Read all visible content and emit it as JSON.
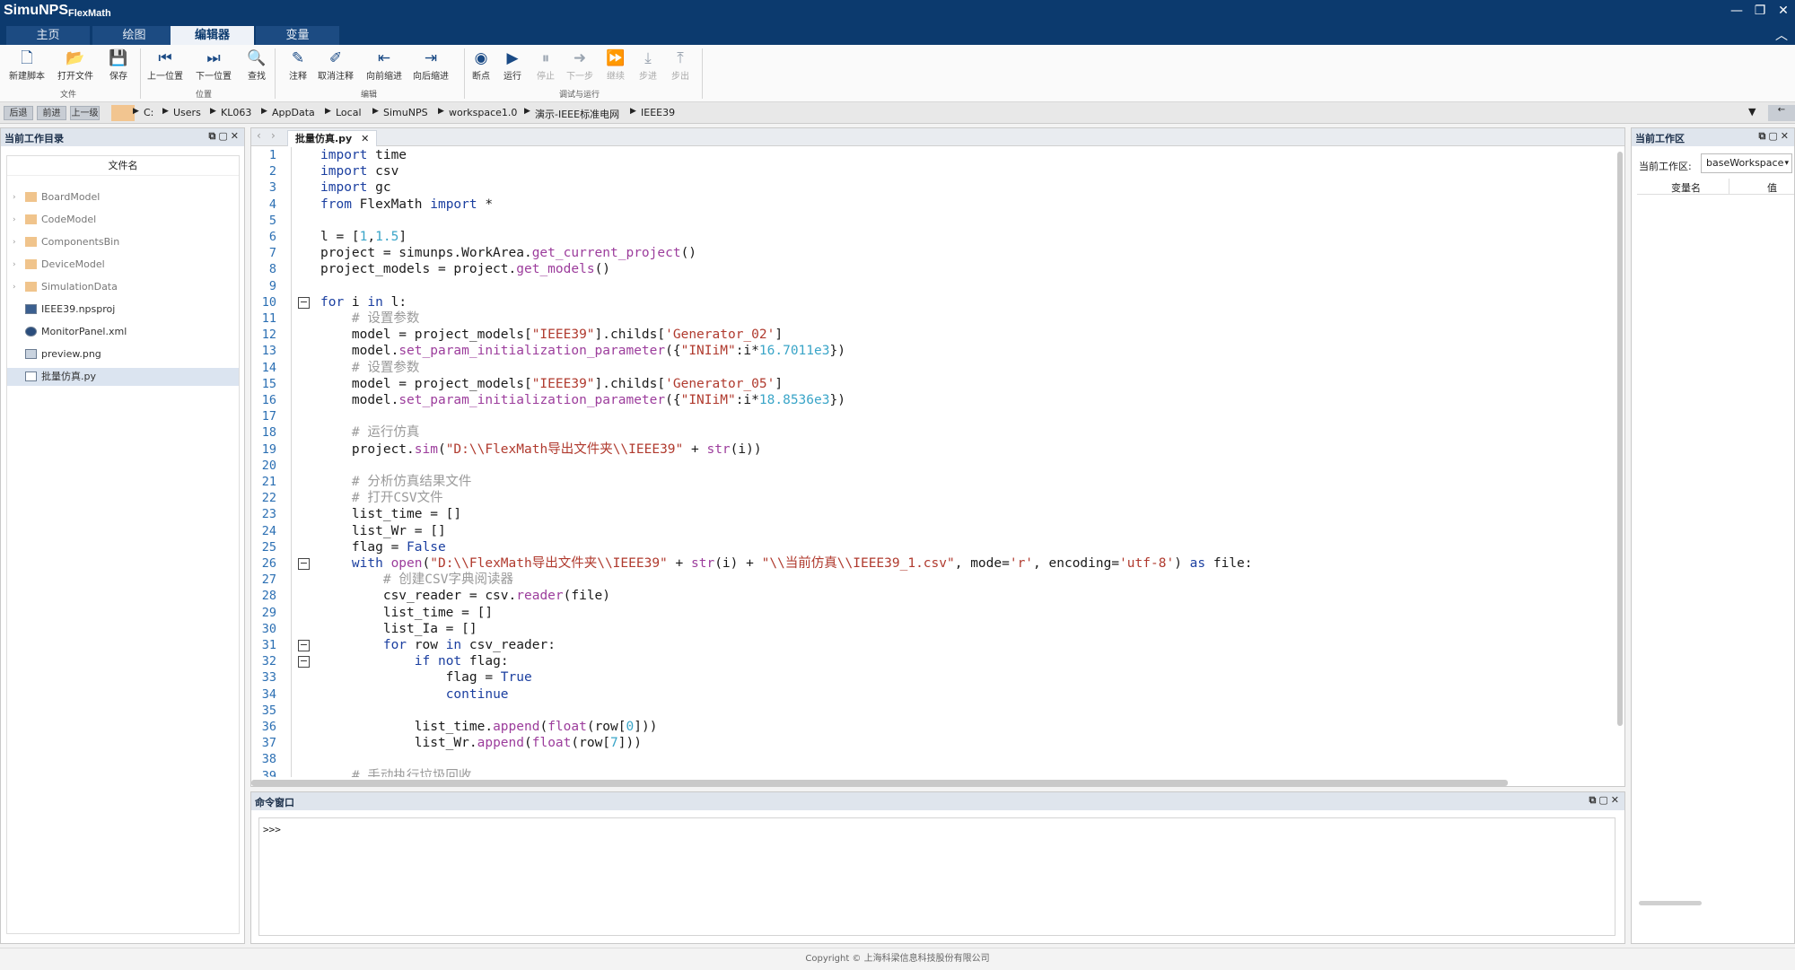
{
  "app": {
    "name": "SimuNPS",
    "subtitle": "FlexMath"
  },
  "window_controls": [
    "—",
    "❐",
    "✕"
  ],
  "tabs": [
    {
      "label": "主页",
      "active": false
    },
    {
      "label": "绘图",
      "active": false
    },
    {
      "label": "编辑器",
      "active": true
    },
    {
      "label": "变量",
      "active": false
    }
  ],
  "ribbon": {
    "buttons": [
      {
        "label": "新建脚本",
        "icon": "new-script-icon",
        "glyph": "🗋",
        "disabled": false
      },
      {
        "label": "打开文件",
        "icon": "open-file-icon",
        "glyph": "📂",
        "disabled": false
      },
      {
        "label": "保存",
        "icon": "save-icon",
        "glyph": "💾",
        "disabled": false
      },
      {
        "label": "上一位置",
        "icon": "prev-position-icon",
        "glyph": "⏮",
        "disabled": false
      },
      {
        "label": "下一位置",
        "icon": "next-position-icon",
        "glyph": "⏭",
        "disabled": false
      },
      {
        "label": "查找",
        "icon": "search-icon",
        "glyph": "🔍",
        "disabled": false
      },
      {
        "label": "注释",
        "icon": "comment-icon",
        "glyph": "✎",
        "disabled": false
      },
      {
        "label": "取消注释",
        "icon": "uncomment-icon",
        "glyph": "✐",
        "disabled": false
      },
      {
        "label": "向前缩进",
        "icon": "indent-decrease-icon",
        "glyph": "⇤",
        "disabled": false
      },
      {
        "label": "向后缩进",
        "icon": "indent-increase-icon",
        "glyph": "⇥",
        "disabled": false
      },
      {
        "label": "断点",
        "icon": "breakpoint-icon",
        "glyph": "◉",
        "disabled": false
      },
      {
        "label": "运行",
        "icon": "run-icon",
        "glyph": "▶",
        "disabled": false
      },
      {
        "label": "停止",
        "icon": "stop-icon",
        "glyph": "⏸",
        "disabled": true
      },
      {
        "label": "下一步",
        "icon": "step-next-icon",
        "glyph": "➜",
        "disabled": true
      },
      {
        "label": "继续",
        "icon": "continue-icon",
        "glyph": "⏩",
        "disabled": true
      },
      {
        "label": "步进",
        "icon": "step-into-icon",
        "glyph": "⤓",
        "disabled": true
      },
      {
        "label": "步出",
        "icon": "step-out-icon",
        "glyph": "⤒",
        "disabled": true
      }
    ],
    "groups": [
      "文件",
      "位置",
      "编辑",
      "调试与运行"
    ]
  },
  "pathbar": {
    "nav": [
      "后退",
      "前进",
      "上一级"
    ],
    "crumbs": [
      "C:",
      "Users",
      "KL063",
      "AppData",
      "Local",
      "SimuNPS",
      "workspace1.0",
      "演示-IEEE标准电网",
      "IEEE39"
    ],
    "up": "←"
  },
  "left_panel": {
    "title": "当前工作目录",
    "column": "文件名",
    "files": [
      {
        "name": "BoardModel",
        "type": "folder"
      },
      {
        "name": "CodeModel",
        "type": "folder"
      },
      {
        "name": "ComponentsBin",
        "type": "folder"
      },
      {
        "name": "DeviceModel",
        "type": "folder"
      },
      {
        "name": "SimulationData",
        "type": "folder"
      },
      {
        "name": "IEEE39.npsproj",
        "type": "project"
      },
      {
        "name": "MonitorPanel.xml",
        "type": "xml"
      },
      {
        "name": "preview.png",
        "type": "image"
      },
      {
        "name": "批量仿真.py",
        "type": "script",
        "selected": true
      }
    ]
  },
  "editor": {
    "tab": "批量仿真.py",
    "lines": [
      "import time",
      "import csv",
      "import gc",
      "from FlexMath import *",
      "",
      "l = [1,1.5]",
      "project = simunps.WorkArea.get_current_project()",
      "project_models = project.get_models()",
      "",
      "for i in l:",
      "    # 设置参数",
      "    model = project_models[\"IEEE39\"].childs['Generator_02']",
      "    model.set_param_initialization_parameter({\"INIiM\":i*16.7011e3})",
      "    # 设置参数",
      "    model = project_models[\"IEEE39\"].childs['Generator_05']",
      "    model.set_param_initialization_parameter({\"INIiM\":i*18.8536e3})",
      "",
      "    # 运行仿真",
      "    project.sim(\"D:\\\\FlexMath导出文件夹\\\\IEEE39\" + str(i))",
      "",
      "    # 分析仿真结果文件",
      "    # 打开CSV文件",
      "    list_time = []",
      "    list_Wr = []",
      "    flag = False",
      "    with open(\"D:\\\\FlexMath导出文件夹\\\\IEEE39\" + str(i) + \"\\\\当前仿真\\\\IEEE39_1.csv\", mode='r', encoding='utf-8') as file:",
      "        # 创建CSV字典阅读器",
      "        csv_reader = csv.reader(file)",
      "        list_time = []",
      "        list_Ia = []",
      "        for row in csv_reader:",
      "            if not flag:",
      "                flag = True",
      "                continue",
      "",
      "            list_time.append(float(row[0]))",
      "            list_Wr.append(float(row[7]))",
      "",
      "    # 手动执行垃圾回收"
    ]
  },
  "command_window": {
    "title": "命令窗口",
    "prompt": ">>>"
  },
  "right_panel": {
    "title": "当前工作区",
    "workspace_label": "当前工作区:",
    "workspace_value": "baseWorkspace",
    "columns": [
      "变量名",
      "值"
    ]
  },
  "footer": "Copyright © 上海科梁信息科技股份有限公司",
  "colors": {
    "title_bar": "#0c3a6e",
    "keyword": "#1b3fa0",
    "string": "#b03a2e",
    "number": "#3aa5c8",
    "comment": "#9a9a9a",
    "function": "#9c3d9c"
  }
}
